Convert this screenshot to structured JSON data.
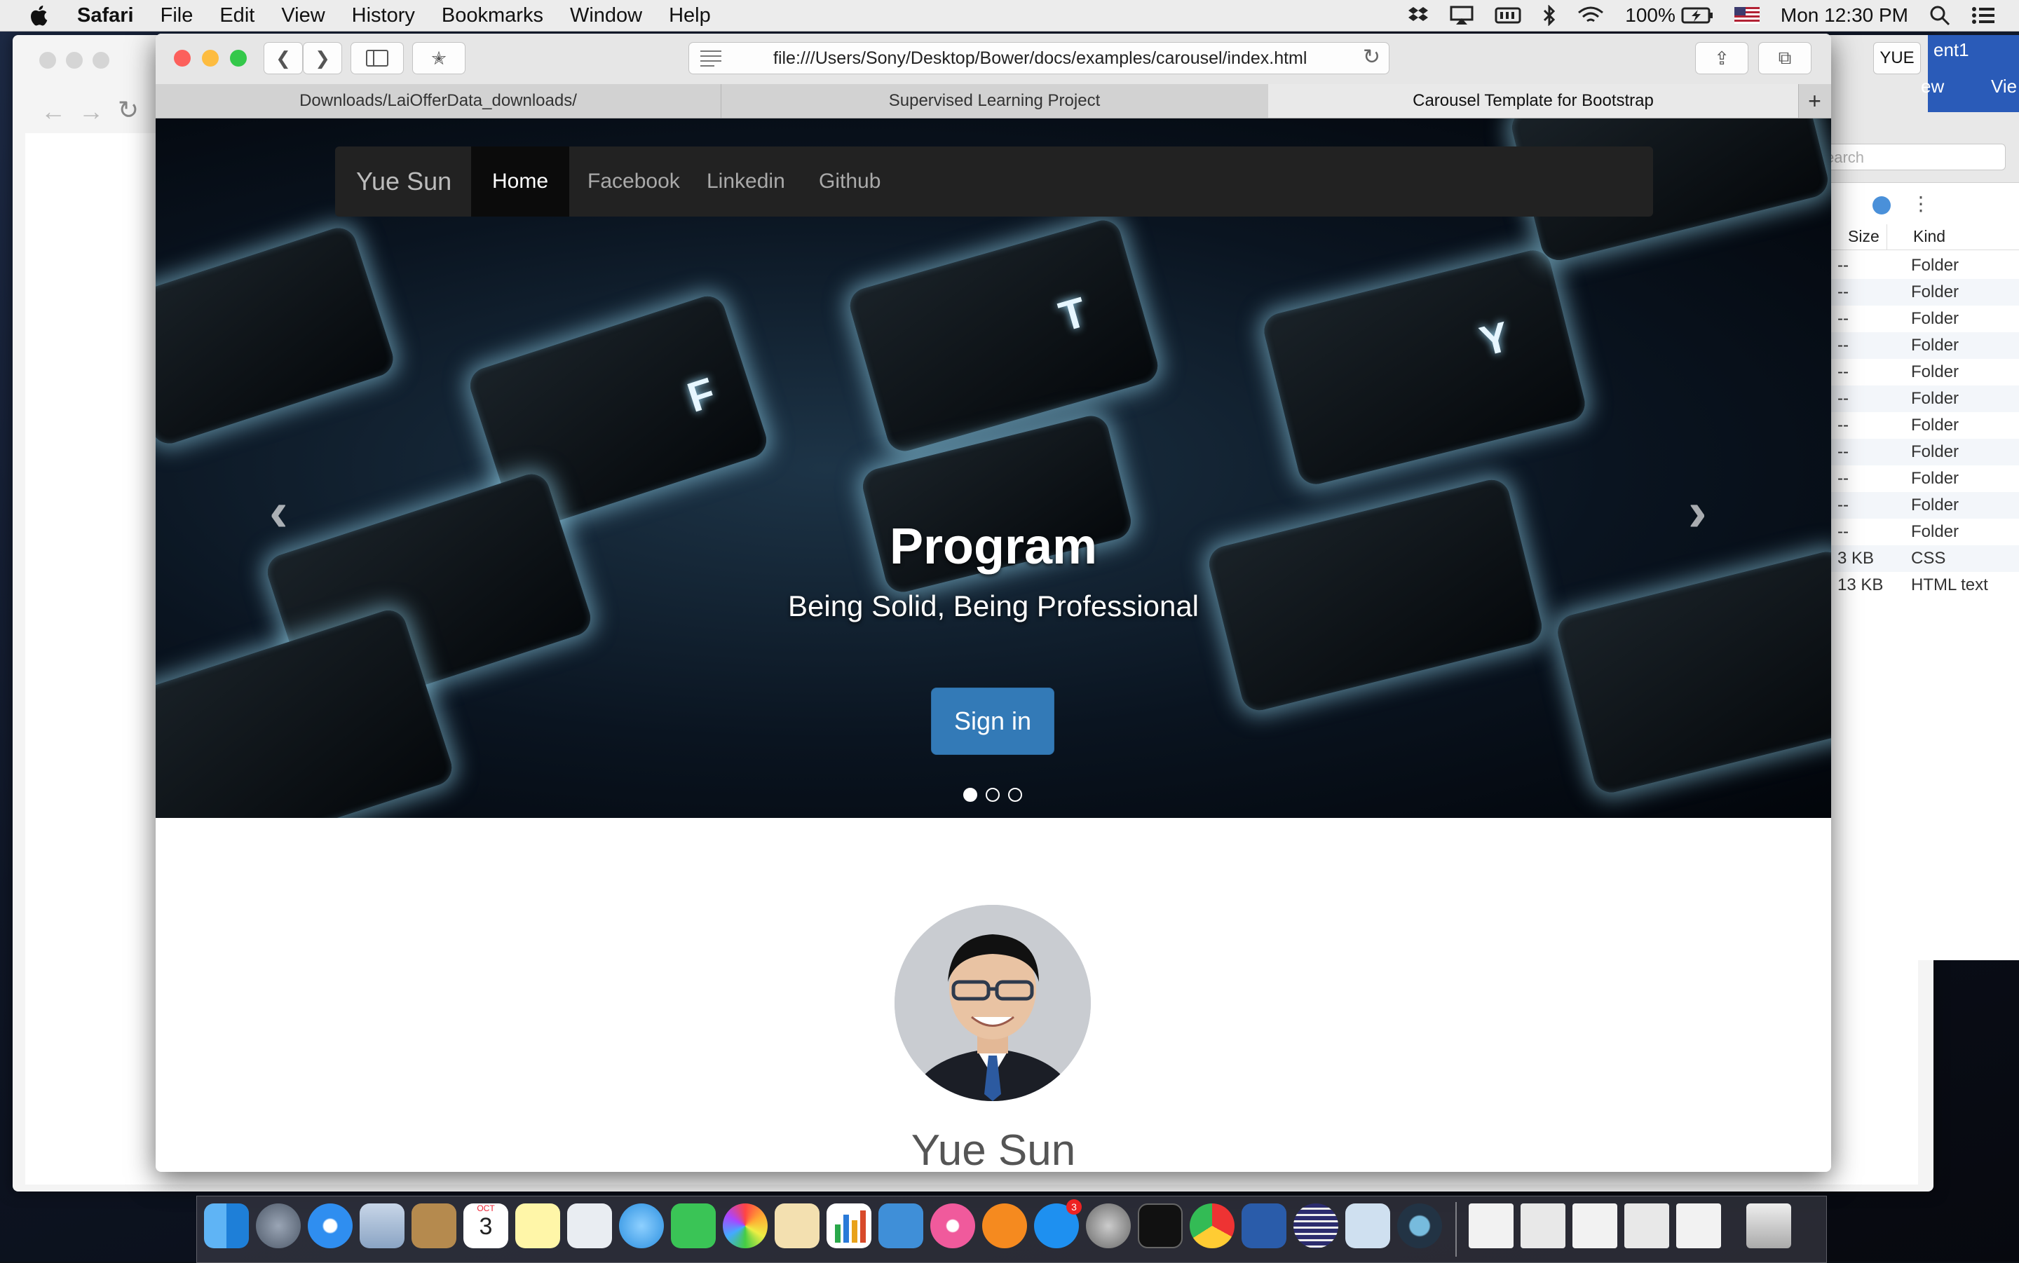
{
  "menubar": {
    "app_name": "Safari",
    "items": [
      "File",
      "Edit",
      "View",
      "History",
      "Bookmarks",
      "Window",
      "Help"
    ],
    "battery": "100%",
    "clock": "Mon 12:30 PM"
  },
  "finder": {
    "search_placeholder": "earch",
    "col_size": "Size",
    "col_kind": "Kind",
    "title_fragment": "ent1",
    "view_fragments": [
      "ew",
      "Vie"
    ],
    "rows": [
      {
        "size": "--",
        "kind": "Folder"
      },
      {
        "size": "--",
        "kind": "Folder"
      },
      {
        "size": "--",
        "kind": "Folder"
      },
      {
        "size": "--",
        "kind": "Folder"
      },
      {
        "size": "--",
        "kind": "Folder"
      },
      {
        "size": "--",
        "kind": "Folder"
      },
      {
        "size": "--",
        "kind": "Folder"
      },
      {
        "size": "--",
        "kind": "Folder"
      },
      {
        "size": "--",
        "kind": "Folder"
      },
      {
        "size": "--",
        "kind": "Folder"
      },
      {
        "size": "--",
        "kind": "Folder"
      },
      {
        "size": "3 KB",
        "kind": "CSS"
      },
      {
        "size": "13 KB",
        "kind": "HTML text"
      }
    ]
  },
  "safari": {
    "url": "file:///Users/Sony/Desktop/Bower/docs/examples/carousel/index.html",
    "user_badge": "YUE",
    "tabs": [
      {
        "label": "Downloads/LaiOfferData_downloads/"
      },
      {
        "label": "Supervised Learning Project"
      },
      {
        "label": "Carousel Template for Bootstrap"
      }
    ],
    "new_tab": "+"
  },
  "page": {
    "brand": "Yue Sun",
    "nav": [
      "Home",
      "Facebook",
      "Linkedin",
      "Github"
    ],
    "carousel": {
      "title": "Program",
      "subtitle": "Being Solid, Being Professional",
      "button": "Sign in",
      "prev": "‹",
      "next": "›",
      "active_index": 1,
      "slides": 3
    },
    "profile_name": "Yue Sun"
  },
  "keyboard_letters": [
    "F",
    "T",
    "Y"
  ],
  "calendar": {
    "month": "OCT",
    "day": "3"
  },
  "appstore_badge": "3",
  "colors": {
    "nav_bg": "#222222",
    "button_primary": "#337ab7",
    "close": "#fc605c",
    "minimize": "#fdbc40",
    "zoom": "#34c84a"
  }
}
